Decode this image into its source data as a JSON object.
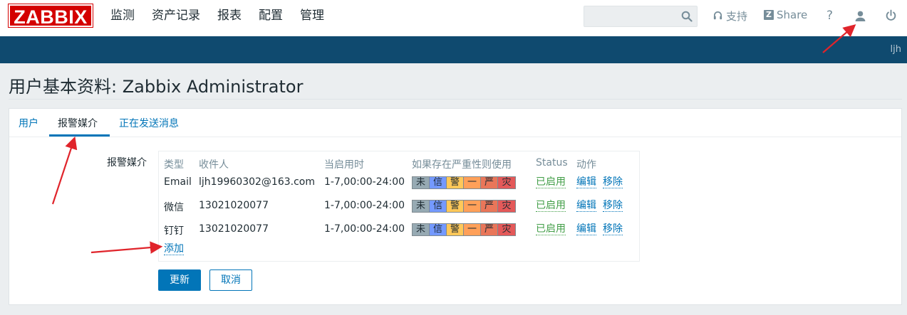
{
  "logo": "ZABBIX",
  "main_nav": [
    "监测",
    "资产记录",
    "报表",
    "配置",
    "管理"
  ],
  "search": {
    "value": "",
    "placeholder": ""
  },
  "top_icons": {
    "support": "支持",
    "share": "Share",
    "help": "?"
  },
  "header_user": "ljh",
  "page_title": "用户基本资料: Zabbix Administrator",
  "tabs": [
    {
      "label": "用户",
      "active": false
    },
    {
      "label": "报警媒介",
      "active": true
    },
    {
      "label": "正在发送消息",
      "active": false
    }
  ],
  "media": {
    "field_label": "报警媒介",
    "headers": [
      "类型",
      "收件人",
      "当启用时",
      "如果存在严重性则使用",
      "Status",
      "动作"
    ],
    "rows": [
      {
        "type": "Email",
        "recipient": "ljh19960302@163.com",
        "when": "1-7,00:00-24:00",
        "status": "已启用",
        "edit": "编辑",
        "remove": "移除"
      },
      {
        "type": "微信",
        "recipient": "13021020077",
        "when": "1-7,00:00-24:00",
        "status": "已启用",
        "edit": "编辑",
        "remove": "移除"
      },
      {
        "type": "钉钉",
        "recipient": "13021020077",
        "when": "1-7,00:00-24:00",
        "status": "已启用",
        "edit": "编辑",
        "remove": "移除"
      }
    ],
    "severities": [
      {
        "label": "未",
        "color": "#97aab3"
      },
      {
        "label": "信",
        "color": "#7499ff"
      },
      {
        "label": "警",
        "color": "#ffc859"
      },
      {
        "label": "一",
        "color": "#ffa059"
      },
      {
        "label": "严",
        "color": "#e97659"
      },
      {
        "label": "灾",
        "color": "#e45959"
      }
    ],
    "add_link": "添加"
  },
  "buttons": {
    "update": "更新",
    "cancel": "取消"
  },
  "colors": {
    "brand_red": "#d40000",
    "header_blue": "#0f4a6f",
    "link_blue": "#0275b8",
    "status_green": "#429e47",
    "annotation_red": "#e0242b"
  }
}
